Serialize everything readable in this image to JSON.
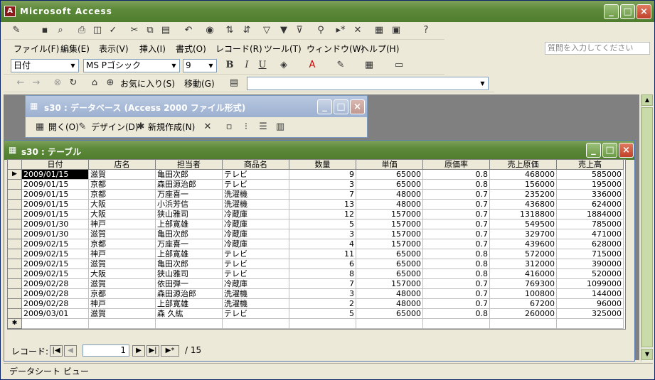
{
  "app": {
    "title": "Microsoft Access"
  },
  "menu": {
    "items": [
      "ファイル(F)",
      "編集(E)",
      "表示(V)",
      "挿入(I)",
      "書式(O)",
      "レコード(R)",
      "ツール(T)",
      "ウィンドウ(W)",
      "ヘルプ(H)"
    ],
    "help_placeholder": "質問を入力してください"
  },
  "format_toolbar": {
    "field": "日付",
    "font": "MS Pゴシック",
    "size": "9"
  },
  "web_toolbar": {
    "favorites": "お気に入り(S)",
    "goto": "移動(G)"
  },
  "db_window": {
    "title": "s30 : データベース (Access 2000 ファイル形式)",
    "open": "開く(O)",
    "design": "デザイン(D)",
    "new": "新規作成(N)"
  },
  "table_window": {
    "title": "s30 : テーブル",
    "columns": [
      "日付",
      "店名",
      "担当者",
      "商品名",
      "数量",
      "単価",
      "原価率",
      "売上原価",
      "売上高"
    ],
    "rows": [
      [
        "2009/01/15",
        "滋賀",
        "亀田次郎",
        "テレビ",
        "9",
        "65000",
        "0.8",
        "468000",
        "585000"
      ],
      [
        "2009/01/15",
        "京都",
        "森田源治郎",
        "テレビ",
        "3",
        "65000",
        "0.8",
        "156000",
        "195000"
      ],
      [
        "2009/01/15",
        "京都",
        "万座喜一",
        "洗濯機",
        "7",
        "48000",
        "0.7",
        "235200",
        "336000"
      ],
      [
        "2009/01/15",
        "大阪",
        "小浜芳信",
        "洗濯機",
        "13",
        "48000",
        "0.7",
        "436800",
        "624000"
      ],
      [
        "2009/01/15",
        "大阪",
        "狭山雅司",
        "冷蔵庫",
        "12",
        "157000",
        "0.7",
        "1318800",
        "1884000"
      ],
      [
        "2009/01/30",
        "神戸",
        "上部寛雄",
        "冷蔵庫",
        "5",
        "157000",
        "0.7",
        "549500",
        "785000"
      ],
      [
        "2009/01/30",
        "滋賀",
        "亀田次郎",
        "冷蔵庫",
        "3",
        "157000",
        "0.7",
        "329700",
        "471000"
      ],
      [
        "2009/02/15",
        "京都",
        "万座喜一",
        "冷蔵庫",
        "4",
        "157000",
        "0.7",
        "439600",
        "628000"
      ],
      [
        "2009/02/15",
        "神戸",
        "上部寛雄",
        "テレビ",
        "11",
        "65000",
        "0.8",
        "572000",
        "715000"
      ],
      [
        "2009/02/15",
        "滋賀",
        "亀田次郎",
        "テレビ",
        "6",
        "65000",
        "0.8",
        "312000",
        "390000"
      ],
      [
        "2009/02/15",
        "大阪",
        "狭山雅司",
        "テレビ",
        "8",
        "65000",
        "0.8",
        "416000",
        "520000"
      ],
      [
        "2009/02/28",
        "滋賀",
        "依田弾一",
        "冷蔵庫",
        "7",
        "157000",
        "0.7",
        "769300",
        "1099000"
      ],
      [
        "2009/02/28",
        "京都",
        "森田源治郎",
        "洗濯機",
        "3",
        "48000",
        "0.7",
        "100800",
        "144000"
      ],
      [
        "2009/02/28",
        "神戸",
        "上部寛雄",
        "洗濯機",
        "2",
        "48000",
        "0.7",
        "67200",
        "96000"
      ],
      [
        "2009/03/01",
        "滋賀",
        "森 久紘",
        "テレビ",
        "5",
        "65000",
        "0.8",
        "260000",
        "325000"
      ]
    ],
    "record_label": "レコード:",
    "current_record": "1",
    "record_total": "/ 15"
  },
  "status": {
    "text": "データシート ビュー"
  }
}
